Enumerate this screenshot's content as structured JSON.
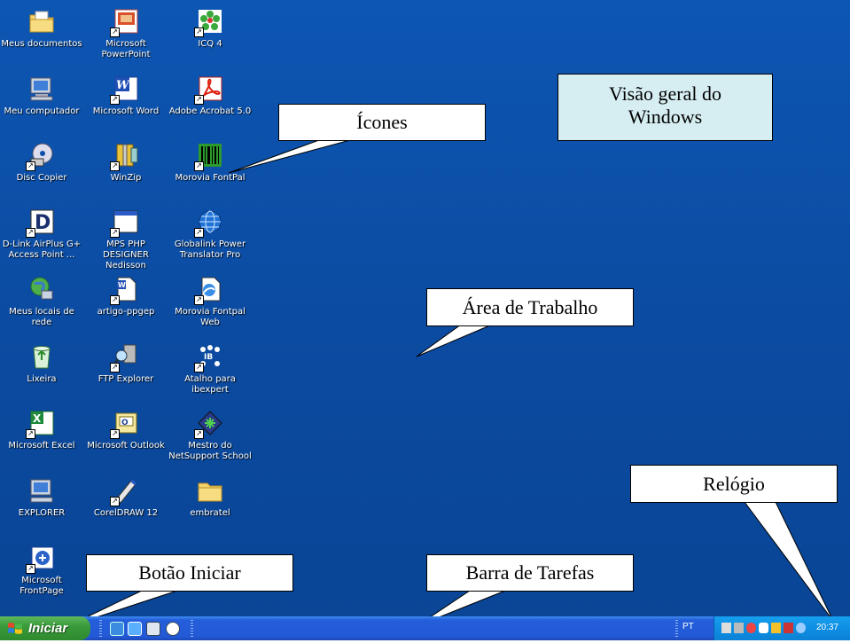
{
  "desktop": {
    "icons": [
      {
        "label": "Meus documentos",
        "icon": "folder-documents-icon",
        "shortcut": false
      },
      {
        "label": "Microsoft PowerPoint",
        "icon": "powerpoint-icon",
        "shortcut": true
      },
      {
        "label": "ICQ 4",
        "icon": "icq-flower-icon",
        "shortcut": true
      },
      {
        "label": "Meu computador",
        "icon": "computer-icon",
        "shortcut": false
      },
      {
        "label": "Microsoft Word",
        "icon": "word-icon",
        "shortcut": true
      },
      {
        "label": "Adobe Acrobat 5.0",
        "icon": "acrobat-icon",
        "shortcut": true
      },
      {
        "label": "Disc Copier",
        "icon": "disc-icon",
        "shortcut": true
      },
      {
        "label": "WinZip",
        "icon": "winzip-icon",
        "shortcut": true
      },
      {
        "label": "Morovia FontPal",
        "icon": "barcode-icon",
        "shortcut": true
      },
      {
        "label": "D-Link AirPlus G+ Access Point ...",
        "icon": "dlink-icon",
        "shortcut": true
      },
      {
        "label": "MPS PHP DESIGNER Nedisson",
        "icon": "window-app-icon",
        "shortcut": true
      },
      {
        "label": "Globalink Power Translator Pro",
        "icon": "globe-icon",
        "shortcut": true
      },
      {
        "label": "Meus locais de rede",
        "icon": "network-icon",
        "shortcut": false
      },
      {
        "label": "artigo-ppgep",
        "icon": "word-document-icon",
        "shortcut": true
      },
      {
        "label": "Morovia Fontpal Web",
        "icon": "web-document-icon",
        "shortcut": true
      },
      {
        "label": "Lixeira",
        "icon": "recycle-bin-icon",
        "shortcut": false
      },
      {
        "label": "FTP Explorer",
        "icon": "ftp-explorer-icon",
        "shortcut": true
      },
      {
        "label": "Atalho para ibexpert",
        "icon": "ibexpert-icon",
        "shortcut": true
      },
      {
        "label": "Microsoft Excel",
        "icon": "excel-icon",
        "shortcut": true
      },
      {
        "label": "Microsoft Outlook",
        "icon": "outlook-icon",
        "shortcut": true
      },
      {
        "label": "Mestro do NetSupport School",
        "icon": "netsupport-icon",
        "shortcut": true
      },
      {
        "label": "EXPLORER",
        "icon": "explorer-computer-icon",
        "shortcut": false
      },
      {
        "label": "CorelDRAW 12",
        "icon": "coreldraw-icon",
        "shortcut": true
      },
      {
        "label": "embratel",
        "icon": "folder-icon",
        "shortcut": false
      },
      {
        "label": "Microsoft FrontPage",
        "icon": "frontpage-icon",
        "shortcut": true
      }
    ]
  },
  "callouts": {
    "icones": "Ícones",
    "visao_l1": "Visão geral do",
    "visao_l2": "Windows",
    "area": "Área de Trabalho",
    "relogio": "Relógio",
    "botao": "Botão Iniciar",
    "barra": "Barra de Tarefas"
  },
  "taskbar": {
    "start_label": "Iniciar",
    "language": "PT",
    "clock": "20:37"
  },
  "colors": {
    "desktop": "#0c4fa8",
    "taskbar": "#245edb",
    "start": "#3a9b3a",
    "tray": "#0f8ee3",
    "visao_box": "#d6eef2"
  }
}
